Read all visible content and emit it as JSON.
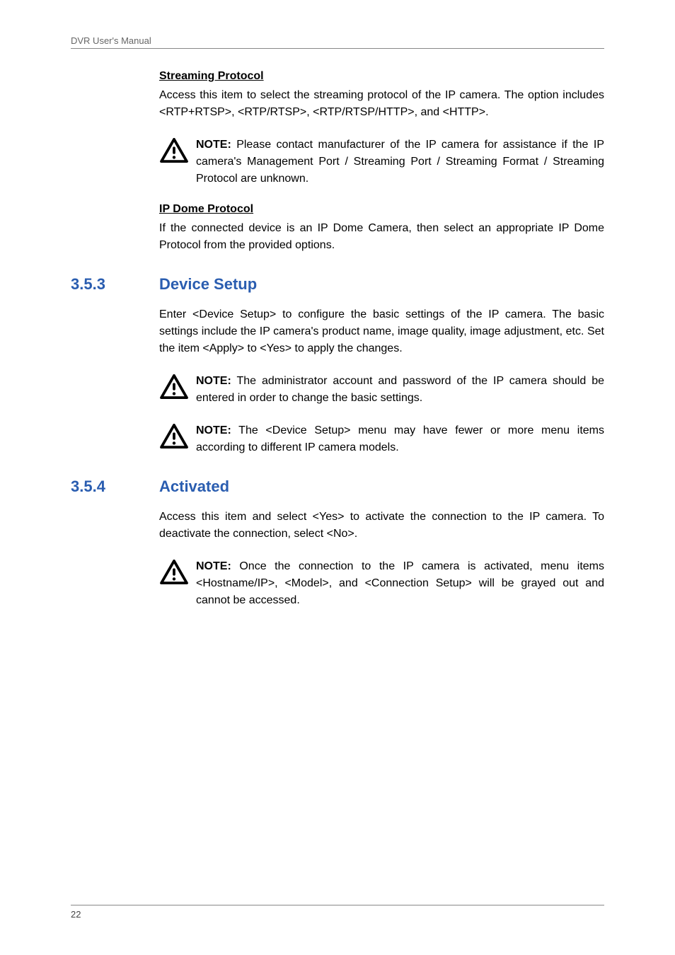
{
  "header": {
    "title": "DVR User's Manual"
  },
  "section_streaming": {
    "title": "Streaming Protocol",
    "body": "Access this item to select the streaming protocol of the IP camera. The option includes <RTP+RTSP>, <RTP/RTSP>, <RTP/RTSP/HTTP>, and <HTTP>."
  },
  "note1": {
    "label": "NOTE:",
    "text": " Please contact manufacturer of the IP camera for assistance if the IP camera's Management Port / Streaming Port / Streaming Format / Streaming Protocol are unknown."
  },
  "section_ipdome": {
    "title": "IP Dome Protocol",
    "body": "If the connected device is an IP Dome Camera, then select an appropriate IP Dome Protocol from the provided options."
  },
  "section353": {
    "number": "3.5.3",
    "title": "Device Setup",
    "body": "Enter <Device Setup> to configure the basic settings of the IP camera. The basic settings include the IP camera's product name, image quality, image adjustment, etc. Set the item <Apply> to <Yes> to apply the changes."
  },
  "note2": {
    "label": "NOTE:",
    "text": " The administrator account and password of the IP camera should be entered in order to change the basic settings."
  },
  "note3": {
    "label": "NOTE:",
    "text": " The <Device Setup> menu may have fewer or more menu items according to different IP camera models."
  },
  "section354": {
    "number": "3.5.4",
    "title": "Activated",
    "body": "Access this item and select <Yes> to activate the connection to the IP camera. To deactivate the connection, select <No>."
  },
  "note4": {
    "label": "NOTE:",
    "text": " Once the connection to the IP camera is activated, menu items <Hostname/IP>, <Model>, and <Connection Setup> will be grayed out and cannot be accessed."
  },
  "footer": {
    "page": "22"
  }
}
